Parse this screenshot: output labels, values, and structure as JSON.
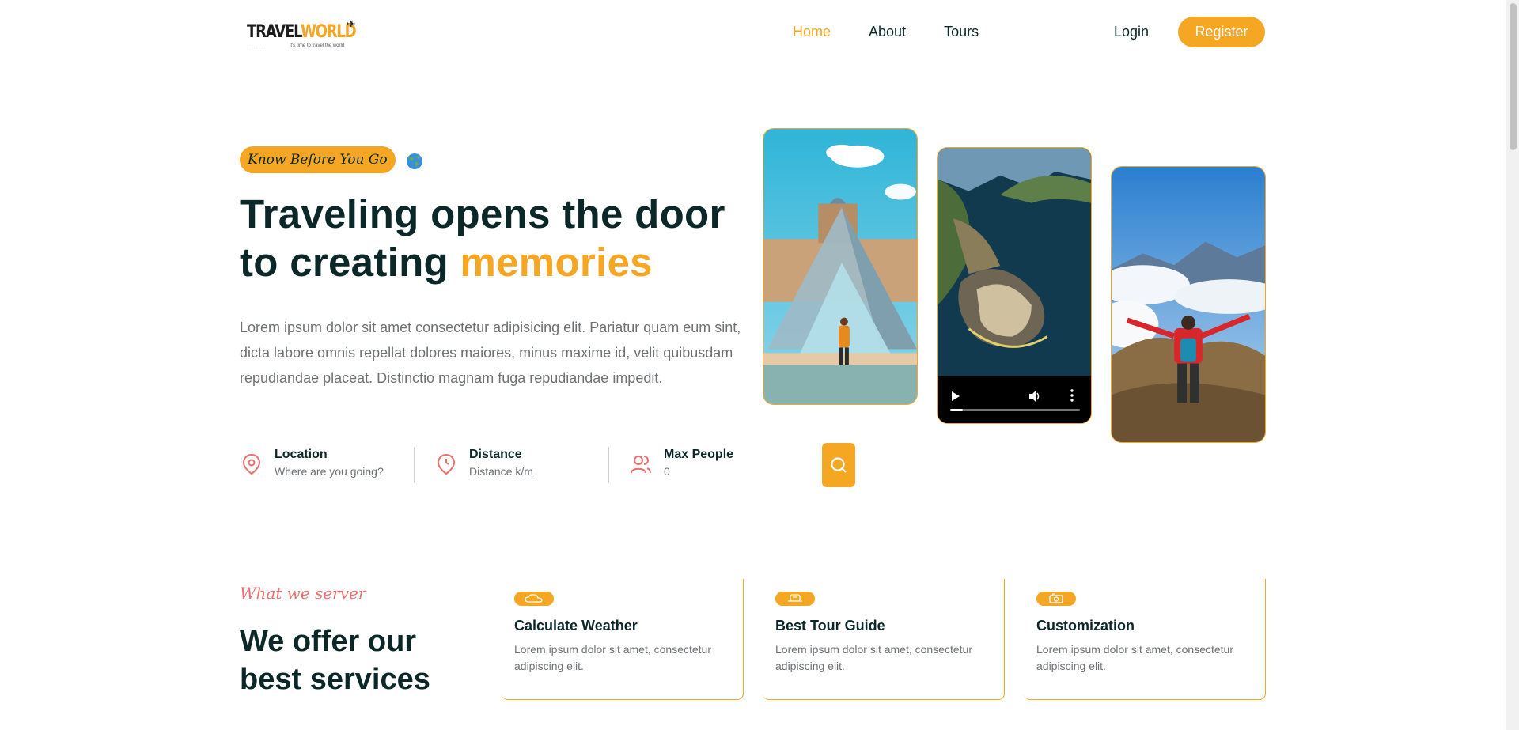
{
  "header": {
    "logo": {
      "text_part1": "TRAVEL",
      "text_part2": "WORLD",
      "tagline": "it's time to travel the world",
      "icon": "airplane-icon"
    },
    "nav": [
      {
        "label": "Home",
        "active": true
      },
      {
        "label": "About",
        "active": false
      },
      {
        "label": "Tours",
        "active": false
      }
    ],
    "login_label": "Login",
    "register_label": "Register"
  },
  "hero": {
    "subtitle": "Know Before You Go",
    "subtitle_icon": "globe-icon",
    "title_main": "Traveling opens the door to creating ",
    "title_highlight": "memories",
    "description": "Lorem ipsum dolor sit amet consectetur adipisicing elit. Pariatur quam eum sint, dicta labore omnis repellat dolores maiores, minus maxime id, velit quibusdam repudiandae placeat. Distinctio magnam fuga repudiandae impedit.",
    "media": [
      {
        "type": "image",
        "icon": "louvre-pyramid-photo"
      },
      {
        "type": "video",
        "icon": "coastal-fort-video",
        "progress": 0.1
      },
      {
        "type": "image",
        "icon": "hiker-mountain-photo"
      }
    ]
  },
  "search": {
    "fields": [
      {
        "label": "Location",
        "placeholder": "Where are you going?",
        "icon": "map-pin-icon"
      },
      {
        "label": "Distance",
        "placeholder": "Distance k/m",
        "icon": "map-time-icon"
      },
      {
        "label": "Max People",
        "placeholder": "0",
        "icon": "group-icon"
      }
    ],
    "button_icon": "search-icon"
  },
  "services": {
    "subtitle": "What we server",
    "title": "We offer our best services",
    "cards": [
      {
        "title": "Calculate Weather",
        "description": "Lorem ipsum dolor sit amet, consectetur adipiscing elit.",
        "icon": "weather-icon"
      },
      {
        "title": "Best Tour Guide",
        "description": "Lorem ipsum dolor sit amet, consectetur adipiscing elit.",
        "icon": "guide-icon"
      },
      {
        "title": "Customization",
        "description": "Lorem ipsum dolor sit amet, consectetur adipiscing elit.",
        "icon": "customization-icon"
      }
    ]
  },
  "colors": {
    "accent": "#f5a623",
    "heading": "#0b2727",
    "text": "#6e7074",
    "secondary": "#ee6e6e"
  }
}
